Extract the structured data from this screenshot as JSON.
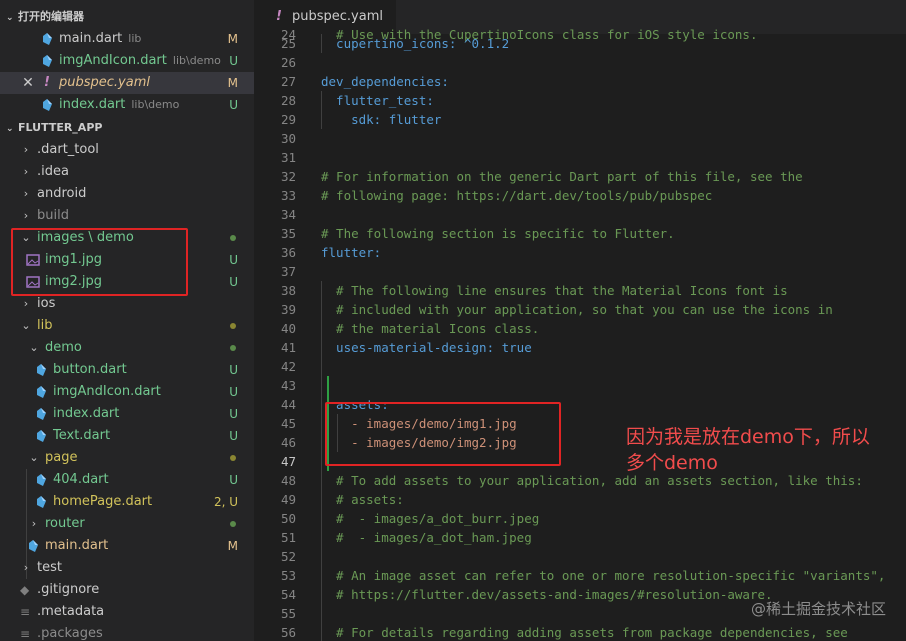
{
  "sidebar": {
    "open_editors": {
      "title": "打开的编辑器",
      "items": [
        {
          "name": "main.dart",
          "desc": "lib",
          "badge": "M"
        },
        {
          "name": "imgAndIcon.dart",
          "desc": "lib\\demo",
          "badge": "U"
        },
        {
          "name": "pubspec.yaml",
          "desc": "",
          "badge": "M"
        },
        {
          "name": "index.dart",
          "desc": "lib\\demo",
          "badge": "U"
        }
      ]
    },
    "project": {
      "title": "FLUTTER_APP",
      "tree": [
        {
          "label": ".dart_tool"
        },
        {
          "label": ".idea"
        },
        {
          "label": "android"
        },
        {
          "label": "build"
        },
        {
          "label": "images \\ demo"
        },
        {
          "label": "img1.jpg",
          "badge": "U"
        },
        {
          "label": "img2.jpg",
          "badge": "U"
        },
        {
          "label": "ios"
        },
        {
          "label": "lib"
        },
        {
          "label": "demo"
        },
        {
          "label": "button.dart",
          "badge": "U"
        },
        {
          "label": "imgAndIcon.dart",
          "badge": "U"
        },
        {
          "label": "index.dart",
          "badge": "U"
        },
        {
          "label": "Text.dart",
          "badge": "U"
        },
        {
          "label": "page"
        },
        {
          "label": "404.dart",
          "badge": "U"
        },
        {
          "label": "homePage.dart",
          "badge": "2, U"
        },
        {
          "label": "router"
        },
        {
          "label": "main.dart",
          "badge": "M"
        },
        {
          "label": "test"
        },
        {
          "label": ".gitignore"
        },
        {
          "label": ".metadata"
        },
        {
          "label": ".packages"
        }
      ]
    }
  },
  "editor": {
    "tab": {
      "title": "pubspec.yaml"
    },
    "lines": [
      {
        "n": "24",
        "text": "  # Use with the CupertinoIcons class for iOS style icons."
      },
      {
        "n": "25",
        "text": "  cupertino_icons: ^0.1.2"
      },
      {
        "n": "26",
        "text": ""
      },
      {
        "n": "27",
        "text": "dev_dependencies:"
      },
      {
        "n": "28",
        "text": "  flutter_test:"
      },
      {
        "n": "29",
        "text": "    sdk: flutter"
      },
      {
        "n": "30",
        "text": ""
      },
      {
        "n": "31",
        "text": ""
      },
      {
        "n": "32",
        "text": "# For information on the generic Dart part of this file, see the"
      },
      {
        "n": "33",
        "text": "# following page: https://dart.dev/tools/pub/pubspec"
      },
      {
        "n": "34",
        "text": ""
      },
      {
        "n": "35",
        "text": "# The following section is specific to Flutter."
      },
      {
        "n": "36",
        "text": "flutter:"
      },
      {
        "n": "37",
        "text": ""
      },
      {
        "n": "38",
        "text": "  # The following line ensures that the Material Icons font is"
      },
      {
        "n": "39",
        "text": "  # included with your application, so that you can use the icons in"
      },
      {
        "n": "40",
        "text": "  # the material Icons class."
      },
      {
        "n": "41",
        "text": "  uses-material-design: true"
      },
      {
        "n": "42",
        "text": ""
      },
      {
        "n": "43",
        "text": ""
      },
      {
        "n": "44",
        "text": "  assets:"
      },
      {
        "n": "45",
        "text": "    - images/demo/img1.jpg"
      },
      {
        "n": "46",
        "text": "    - images/demo/img2.jpg"
      },
      {
        "n": "47",
        "text": ""
      },
      {
        "n": "48",
        "text": "  # To add assets to your application, add an assets section, like this:"
      },
      {
        "n": "49",
        "text": "  # assets:"
      },
      {
        "n": "50",
        "text": "  #  - images/a_dot_burr.jpeg"
      },
      {
        "n": "51",
        "text": "  #  - images/a_dot_ham.jpeg"
      },
      {
        "n": "52",
        "text": ""
      },
      {
        "n": "53",
        "text": "  # An image asset can refer to one or more resolution-specific \"variants\","
      },
      {
        "n": "54",
        "text": "  # https://flutter.dev/assets-and-images/#resolution-aware."
      },
      {
        "n": "55",
        "text": ""
      },
      {
        "n": "56",
        "text": "  # For details regarding adding assets from package dependencies, see"
      }
    ]
  },
  "annotation": {
    "line1": "因为我是放在demo下，所以",
    "line2": "多个demo"
  },
  "watermark": "@稀土掘金技术社区",
  "colors": {
    "annotation_red": "#e02424",
    "git_untracked": "#73c991",
    "git_modified": "#e2c08d"
  }
}
